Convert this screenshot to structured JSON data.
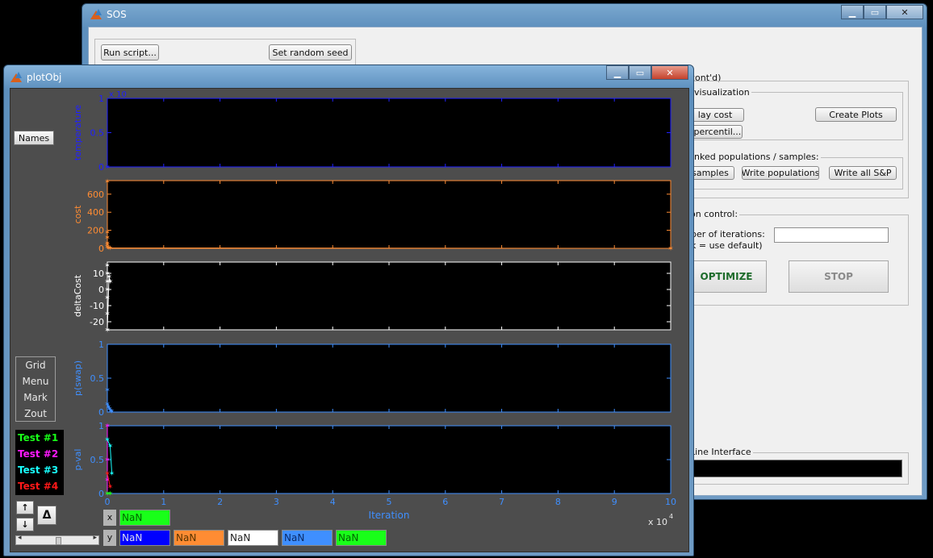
{
  "sos_window": {
    "title": "SOS",
    "run_script_label": "Run script...",
    "set_seed_label": "Set random seed",
    "group_viz_header": "cont'd)",
    "group_viz_label": "visualization",
    "display_cost_label": "lay cost",
    "create_plots_label": "Create Plots",
    "percentile_label": "t percentil...",
    "ranked_label": "nked populations / samples:",
    "samples_label": "samples",
    "write_pops_label": "Write populations",
    "write_all_label": "Write all S&P",
    "control_label": "on control:",
    "iterations_line1": "ber of iterations:",
    "iterations_line2": "k = use default)",
    "optimize_label": "OPTIMIZE",
    "stop_label": "STOP",
    "cli_label": "Line Interface"
  },
  "plot_window": {
    "title": "plotObj",
    "names_label": "Names",
    "menu_items": [
      "Grid",
      "Menu",
      "Mark",
      "Zout"
    ],
    "tests": [
      {
        "label": "Test #1",
        "color": "#19ff19"
      },
      {
        "label": "Test #2",
        "color": "#ff19ff"
      },
      {
        "label": "Test #3",
        "color": "#19ffff"
      },
      {
        "label": "Test #4",
        "color": "#ff1919"
      }
    ],
    "up_label": "↑",
    "down_label": "↓",
    "delta_label": "Δ",
    "x_label": "x",
    "y_label": "y",
    "x_readout": {
      "value": "NaN",
      "color": "#19ff19"
    },
    "y_readouts": [
      {
        "value": "NaN",
        "color": "#0000ff"
      },
      {
        "value": "NaN",
        "color": "#ff8c33"
      },
      {
        "value": "NaN",
        "color": "#ffffff"
      },
      {
        "value": "NaN",
        "color": "#3f8fff"
      },
      {
        "value": "NaN",
        "color": "#19ff19"
      }
    ]
  },
  "chart_data": {
    "type": "line",
    "xlabel": "Iteration",
    "x_exponent": "x 10",
    "x_exponent_power": "4",
    "xlim": [
      0,
      10
    ],
    "x_ticks": [
      "0",
      "1",
      "2",
      "3",
      "4",
      "5",
      "6",
      "7",
      "8",
      "9",
      "10"
    ],
    "panels": [
      {
        "ylabel": "temperature",
        "color": "#2020ff",
        "ylim": [
          0,
          1
        ],
        "y_ticks": [
          "0",
          "0.5",
          "1"
        ],
        "exponent_text": "x 10",
        "series": [
          {
            "name": "",
            "x": [
              0
            ],
            "y": [
              0
            ]
          }
        ]
      },
      {
        "ylabel": "cost",
        "color": "#ff8c33",
        "ylim": [
          0,
          750
        ],
        "y_ticks": [
          "0",
          "200",
          "400",
          "600"
        ],
        "series": [
          {
            "x": [
              0,
              0,
              0,
              0,
              0,
              0,
              0.02,
              0.05,
              10
            ],
            "y": [
              740,
              180,
              120,
              60,
              40,
              20,
              10,
              5,
              0
            ]
          }
        ]
      },
      {
        "ylabel": "deltaCost",
        "color": "#ffffff",
        "ylim": [
          -25,
          17
        ],
        "y_ticks": [
          "-20",
          "-10",
          "0",
          "10"
        ],
        "series": [
          {
            "x": [
              0,
              0,
              0,
              0,
              0,
              0,
              0,
              0.03,
              0.05
            ],
            "y": [
              15,
              10,
              5,
              0,
              -5,
              -15,
              -25,
              8,
              5
            ]
          }
        ]
      },
      {
        "ylabel": "p(swap)",
        "color": "#3f8fff",
        "ylim": [
          0,
          1
        ],
        "y_ticks": [
          "0",
          "0.5",
          "1"
        ],
        "series": [
          {
            "x": [
              0,
              0,
              0.02,
              0.04,
              0.06,
              0.08
            ],
            "y": [
              0.33,
              0.12,
              0.08,
              0.05,
              0.02,
              0.01
            ]
          }
        ]
      },
      {
        "ylabel": "p-val",
        "color": "#3f8fff",
        "ylim": [
          0,
          1
        ],
        "y_ticks": [
          "0",
          "0.5",
          "1"
        ],
        "series": [
          {
            "x": [
              0,
              0,
              0,
              0
            ],
            "y": [
              1,
              0.5,
              0.2,
              0
            ],
            "color": "#ff19ff"
          },
          {
            "x": [
              0,
              0.05,
              0.08
            ],
            "y": [
              0.8,
              0.7,
              0.3
            ],
            "color": "#19ffff"
          },
          {
            "x": [
              0,
              0.05
            ],
            "y": [
              0.3,
              0.1
            ],
            "color": "#ff1919"
          },
          {
            "x": [
              0,
              0.05
            ],
            "y": [
              0,
              0
            ],
            "color": "#19ff19"
          }
        ]
      }
    ]
  }
}
